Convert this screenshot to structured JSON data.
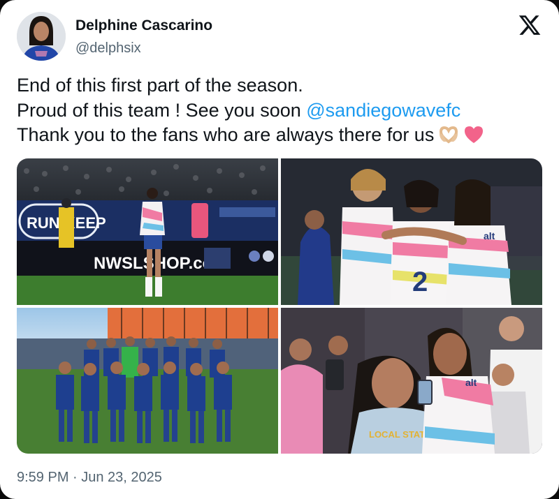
{
  "author": {
    "display_name": "Delphine Cascarino",
    "handle": "@delphsix"
  },
  "platform_icon": "x-logo-icon",
  "tweet": {
    "line1": "End of this first part of the season.",
    "line2_text": "Proud of this team ! See you soon ",
    "line2_mention": "@sandiegowavefc",
    "line3_text": "Thank you to the fans who are always there for us",
    "emojis": [
      "heart-hands-icon",
      "pink-heart-icon"
    ]
  },
  "media": {
    "photo_1": {
      "board_text_1": "RUN KEEP",
      "board_text_2": "NWSLSHOP.com"
    },
    "photo_2": {
      "shirt_text": "alt"
    },
    "photo_4": {
      "shirt_text": "alt",
      "hoodie_text": "LOCAL STATE CUP"
    }
  },
  "footer": {
    "timestamp": "9:59 PM · Jun 23, 2025"
  },
  "colors": {
    "mention": "#1d9bf0",
    "secondary_text": "#536471",
    "primary_text": "#0f1419",
    "team_navy": "#1e3f8f",
    "pitch_green": "#3d7d2e"
  }
}
